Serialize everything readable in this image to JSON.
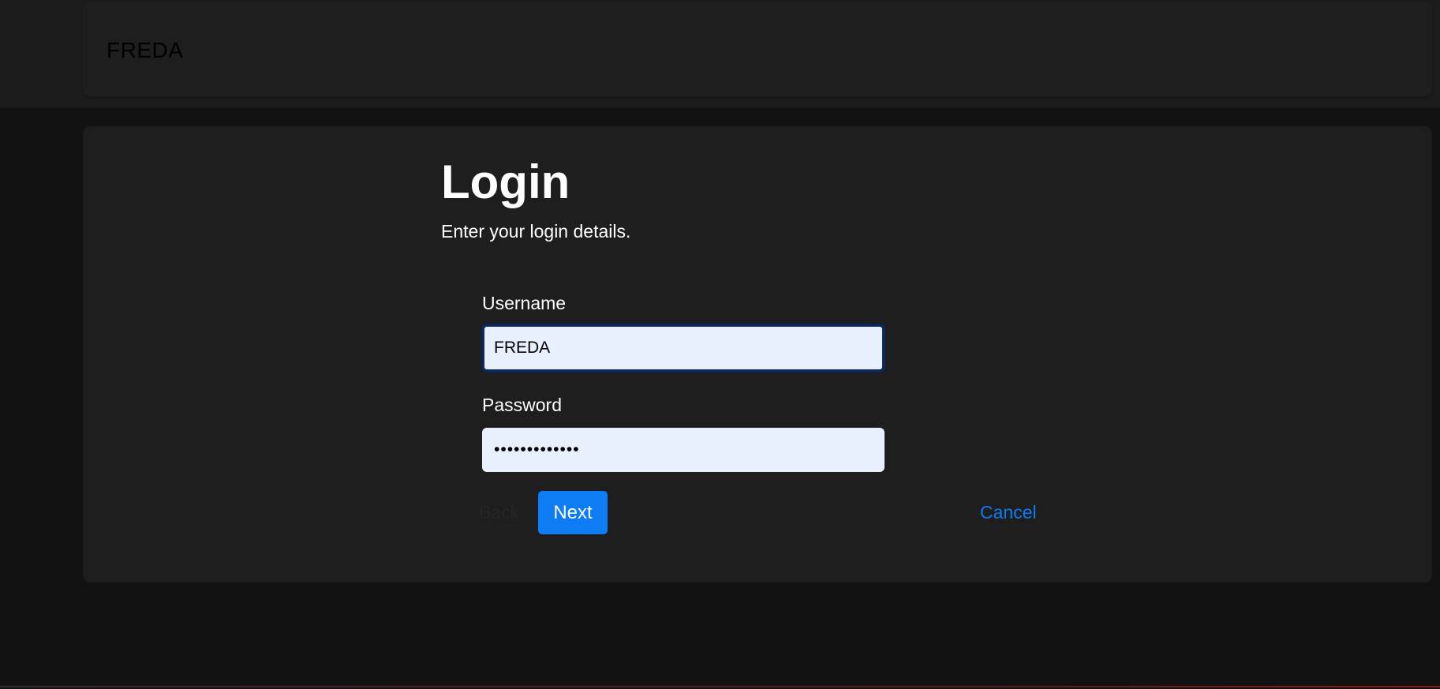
{
  "header": {
    "brand": "FREDA"
  },
  "login": {
    "title": "Login",
    "subtitle": "Enter your login details.",
    "username_label": "Username",
    "username_value": "FREDA",
    "password_label": "Password",
    "password_value": "•••••••••••••",
    "back_label": "Back",
    "next_label": "Next",
    "cancel_label": "Cancel"
  },
  "colors": {
    "accent": "#0d7cf5",
    "background": "#121212",
    "card": "#1e1e1e",
    "input_fill": "#e8f0fe"
  }
}
